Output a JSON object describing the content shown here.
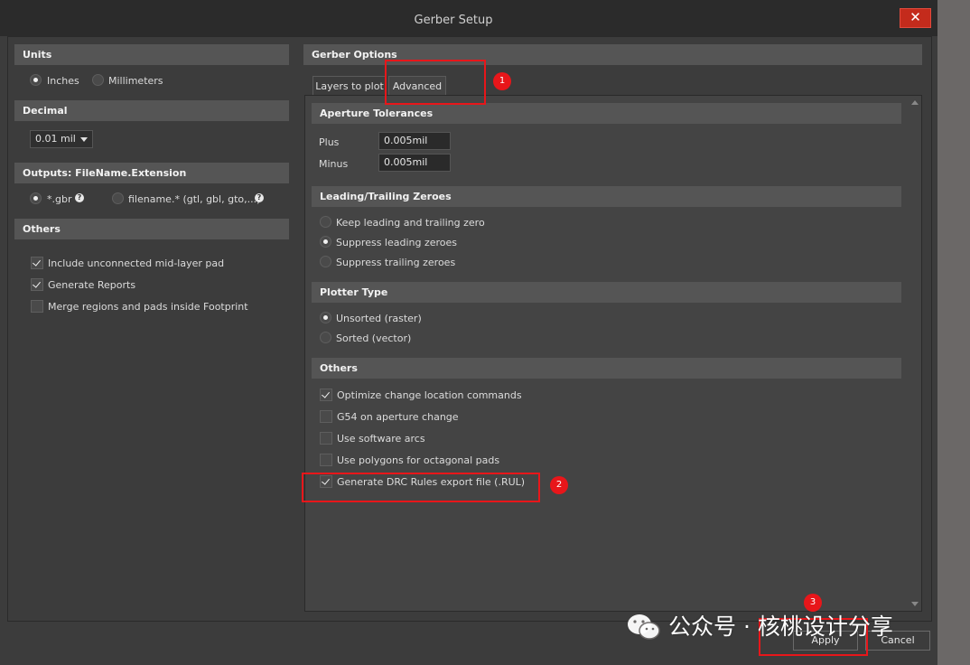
{
  "window": {
    "title": "Gerber Setup",
    "close_label": "✕"
  },
  "left": {
    "units": {
      "header": "Units",
      "inches": "Inches",
      "millimeters": "Millimeters",
      "selected": "Inches"
    },
    "decimal": {
      "header": "Decimal",
      "value": "0.01 mil"
    },
    "outputs": {
      "header": "Outputs: FileName.Extension",
      "opt1": "*.gbr",
      "opt2": "filename.* (gtl, gbl, gto,...)",
      "help": "?"
    },
    "others": {
      "header": "Others",
      "items": [
        {
          "label": "Include unconnected mid-layer pad",
          "checked": true
        },
        {
          "label": "Generate Reports",
          "checked": true
        },
        {
          "label": "Merge regions and pads inside Footprint",
          "checked": false
        }
      ]
    }
  },
  "right": {
    "header": "Gerber Options",
    "tabs": [
      {
        "label": "Layers to plot"
      },
      {
        "label": "Advanced",
        "active": true
      }
    ],
    "aperture": {
      "header": "Aperture Tolerances",
      "plus_label": "Plus",
      "plus_value": "0.005mil",
      "minus_label": "Minus",
      "minus_value": "0.005mil"
    },
    "zeroes": {
      "header": "Leading/Trailing Zeroes",
      "options": [
        {
          "label": "Keep leading and trailing zero",
          "selected": false
        },
        {
          "label": "Suppress leading zeroes",
          "selected": true
        },
        {
          "label": "Suppress trailing zeroes",
          "selected": false
        }
      ]
    },
    "plotter": {
      "header": "Plotter Type",
      "options": [
        {
          "label": "Unsorted (raster)",
          "selected": true
        },
        {
          "label": "Sorted (vector)",
          "selected": false
        }
      ]
    },
    "others": {
      "header": "Others",
      "items": [
        {
          "label": "Optimize change location commands",
          "checked": true
        },
        {
          "label": "G54 on aperture change",
          "checked": false
        },
        {
          "label": "Use software arcs",
          "checked": false
        },
        {
          "label": "Use polygons for octagonal pads",
          "checked": false
        },
        {
          "label": "Generate DRC Rules export file (.RUL)",
          "checked": true
        }
      ]
    }
  },
  "buttons": {
    "apply": "Apply",
    "cancel": "Cancel"
  },
  "annotations": {
    "n1": "1",
    "n2": "2",
    "n3": "3"
  },
  "watermark": {
    "text": "公众号 · 核桃设计分享"
  },
  "colors": {
    "annotation": "#e8161a",
    "background": "#3c3c3c",
    "header": "#555555"
  }
}
